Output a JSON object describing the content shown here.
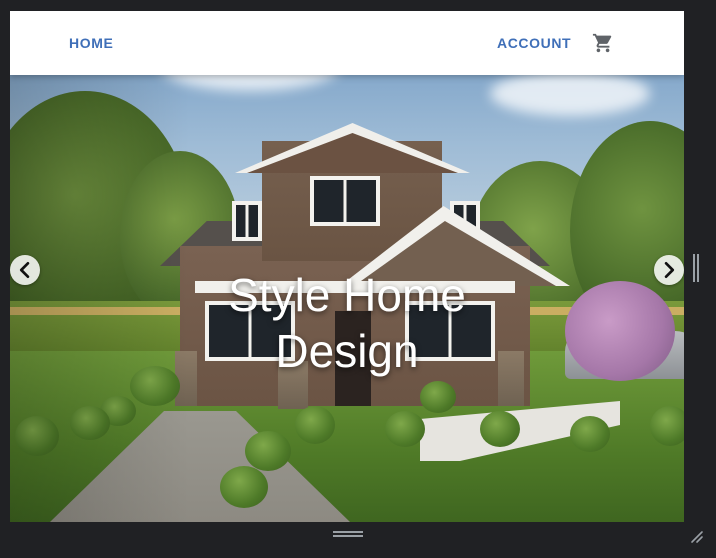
{
  "appbar": {
    "home_label": "HOME",
    "account_label": "ACCOUNT",
    "cart_icon": "shopping-cart-icon"
  },
  "hero": {
    "title_line1": "Style Home",
    "title_line2": "Design",
    "prev_icon": "chevron-left-icon",
    "next_icon": "chevron-right-icon"
  },
  "colors": {
    "nav_text": "#3f6fb8",
    "appbar_bg": "#ffffff",
    "window_bg": "#202124",
    "hero_title": "#ffffff"
  }
}
